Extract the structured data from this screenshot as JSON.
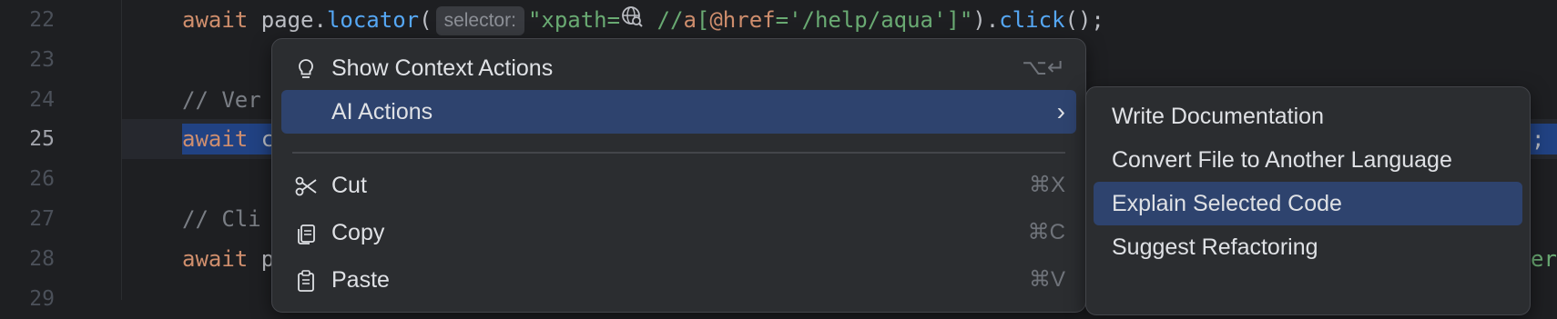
{
  "editor": {
    "line_numbers": [
      "22",
      "23",
      "24",
      "25",
      "26",
      "27",
      "28",
      "29"
    ],
    "active_line": "25",
    "line22": {
      "await": "await",
      "page": " page.",
      "locator": "locator",
      "paren": "(",
      "hint": "selector:",
      "str_open": "\"xpath=",
      "str_mid": " //",
      "xpath_a": "a",
      "xpath_lb": "[",
      "xpath_attr": "@href",
      "xpath_eq": "=",
      "xpath_val": "'/help/aqua'",
      "xpath_rb": "]",
      "str_close": "\"",
      "close": ").",
      "click": "click",
      "end": "();"
    },
    "line24_comment": "// Ver",
    "line25_await": "await",
    "line25_rest": " c",
    "line25_tail": ";",
    "line27_comment": "// Cli",
    "line28_await": "await",
    "line28_rest": " p",
    "line28_tail": "er"
  },
  "context_menu": {
    "items": [
      {
        "label": "Show Context Actions",
        "shortcut": "⌥↵",
        "icon": "lightbulb-icon"
      },
      {
        "label": "AI Actions",
        "shortcut": "›",
        "icon": ""
      },
      {
        "label": "Cut",
        "shortcut": "⌘X",
        "icon": "scissors-icon"
      },
      {
        "label": "Copy",
        "shortcut": "⌘C",
        "icon": "copy-icon"
      },
      {
        "label": "Paste",
        "shortcut": "⌘V",
        "icon": "paste-icon"
      }
    ],
    "highlighted": "AI Actions"
  },
  "submenu": {
    "items": [
      {
        "label": "Write Documentation"
      },
      {
        "label": "Convert File to Another Language"
      },
      {
        "label": "Explain Selected Code"
      },
      {
        "label": "Suggest Refactoring"
      }
    ],
    "highlighted": "Explain Selected Code"
  },
  "colors": {
    "background": "#1e1f22",
    "menu_bg": "#2b2d30",
    "highlight": "#2e436e",
    "selection": "#214283",
    "keyword": "#cf8e6d",
    "function": "#56a8f5",
    "string": "#6aab73"
  }
}
